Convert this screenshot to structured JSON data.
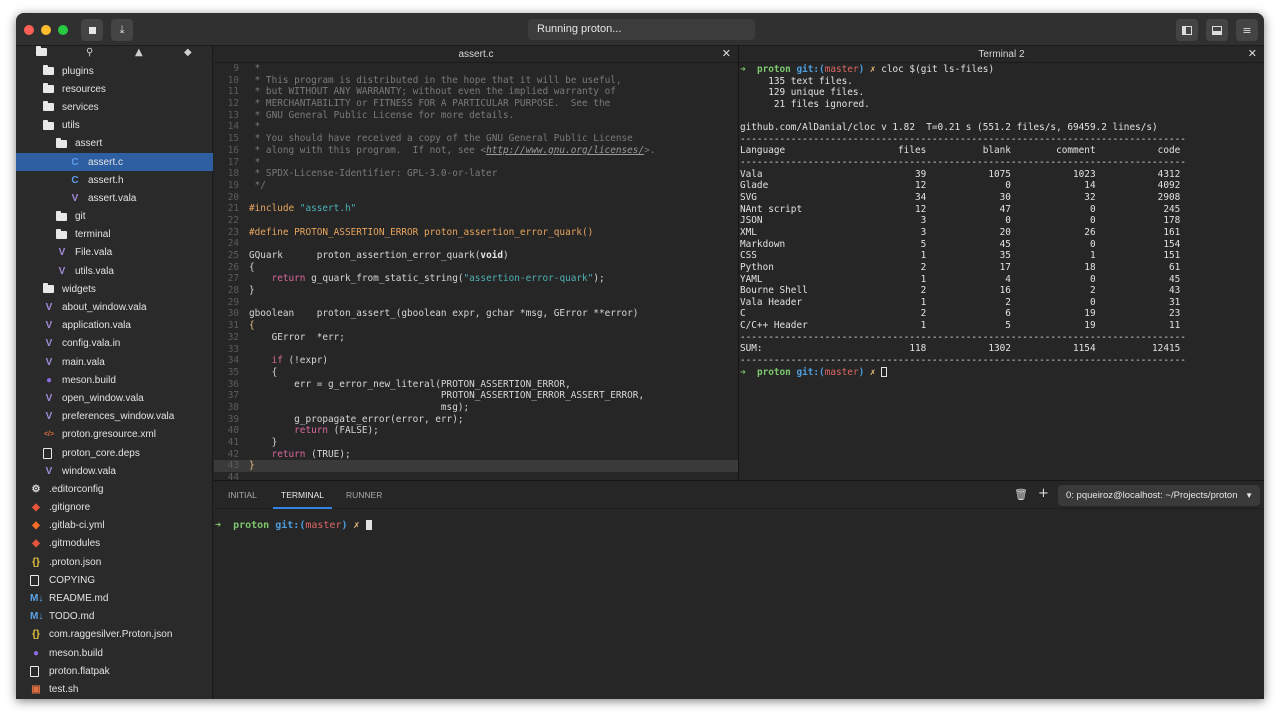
{
  "header": {
    "status": "Running proton...",
    "stop_icon": "stop-icon",
    "download_icon": "download-icon",
    "sidebar_toggle_icon": "sidebar-toggle-icon",
    "panel_toggle_icon": "panel-toggle-icon",
    "menu_icon": "hamburger-menu-icon"
  },
  "sidebar": {
    "toolbar_icons": [
      "folder-icon",
      "search-icon",
      "warning-icon",
      "git-icon"
    ],
    "items": [
      {
        "label": "plugins",
        "kind": "folder",
        "indent": 1
      },
      {
        "label": "resources",
        "kind": "folder",
        "indent": 1
      },
      {
        "label": "services",
        "kind": "folder",
        "indent": 1
      },
      {
        "label": "utils",
        "kind": "folder",
        "indent": 1
      },
      {
        "label": "assert",
        "kind": "folder",
        "indent": 2
      },
      {
        "label": "assert.c",
        "kind": "c",
        "indent": 3,
        "selected": true
      },
      {
        "label": "assert.h",
        "kind": "c",
        "indent": 3
      },
      {
        "label": "assert.vala",
        "kind": "vala",
        "indent": 3
      },
      {
        "label": "git",
        "kind": "folder",
        "indent": 2
      },
      {
        "label": "terminal",
        "kind": "folder",
        "indent": 2
      },
      {
        "label": "File.vala",
        "kind": "vala",
        "indent": 2
      },
      {
        "label": "utils.vala",
        "kind": "vala",
        "indent": 2
      },
      {
        "label": "widgets",
        "kind": "folder",
        "indent": 1
      },
      {
        "label": "about_window.vala",
        "kind": "vala",
        "indent": 1
      },
      {
        "label": "application.vala",
        "kind": "vala",
        "indent": 1
      },
      {
        "label": "config.vala.in",
        "kind": "vala",
        "indent": 1
      },
      {
        "label": "main.vala",
        "kind": "vala",
        "indent": 1
      },
      {
        "label": "meson.build",
        "kind": "meson",
        "indent": 1
      },
      {
        "label": "open_window.vala",
        "kind": "vala",
        "indent": 1
      },
      {
        "label": "preferences_window.vala",
        "kind": "vala",
        "indent": 1
      },
      {
        "label": "proton.gresource.xml",
        "kind": "xml",
        "indent": 1
      },
      {
        "label": "proton_core.deps",
        "kind": "file",
        "indent": 1
      },
      {
        "label": "window.vala",
        "kind": "vala",
        "indent": 1
      },
      {
        "label": ".editorconfig",
        "kind": "gear",
        "indent": 0
      },
      {
        "label": ".gitignore",
        "kind": "git",
        "indent": 0
      },
      {
        "label": ".gitlab-ci.yml",
        "kind": "gitlab",
        "indent": 0
      },
      {
        "label": ".gitmodules",
        "kind": "git",
        "indent": 0
      },
      {
        "label": ".proton.json",
        "kind": "json",
        "indent": 0
      },
      {
        "label": "COPYING",
        "kind": "file",
        "indent": 0
      },
      {
        "label": "README.md",
        "kind": "md",
        "indent": 0
      },
      {
        "label": "TODO.md",
        "kind": "md",
        "indent": 0
      },
      {
        "label": "com.raggesilver.Proton.json",
        "kind": "json",
        "indent": 0
      },
      {
        "label": "meson.build",
        "kind": "meson",
        "indent": 0
      },
      {
        "label": "proton.flatpak",
        "kind": "file",
        "indent": 0
      },
      {
        "label": "test.sh",
        "kind": "sh",
        "indent": 0
      }
    ]
  },
  "editor": {
    "title": "assert.c",
    "close": "✕",
    "lines": [
      {
        "n": "9",
        "html": "<span class='cm'> *</span>"
      },
      {
        "n": "10",
        "html": "<span class='cm'> * This program is distributed in the hope that it will be useful,</span>"
      },
      {
        "n": "11",
        "html": "<span class='cm'> * but WITHOUT ANY WARRANTY; without even the implied warranty of</span>"
      },
      {
        "n": "12",
        "html": "<span class='cm'> * MERCHANTABILITY or FITNESS FOR A PARTICULAR PURPOSE.  See the</span>"
      },
      {
        "n": "13",
        "html": "<span class='cm'> * GNU General Public License for more details.</span>"
      },
      {
        "n": "14",
        "html": "<span class='cm'> *</span>"
      },
      {
        "n": "15",
        "html": "<span class='cm'> * You should have received a copy of the GNU General Public License</span>"
      },
      {
        "n": "16",
        "html": "<span class='cm'> * along with this program.  If not, see &lt;</span><span class='lnk'>http://www.gnu.org/licenses/</span><span class='cm'>&gt;.</span>"
      },
      {
        "n": "17",
        "html": "<span class='cm'> *</span>"
      },
      {
        "n": "18",
        "html": "<span class='cm'> * SPDX-License-Identifier: GPL-3.0-or-later</span>"
      },
      {
        "n": "19",
        "html": "<span class='cm'> */</span>"
      },
      {
        "n": "20",
        "html": ""
      },
      {
        "n": "21",
        "html": "<span class='pp'>#include </span><span class='str'>\"assert.h\"</span>"
      },
      {
        "n": "22",
        "html": ""
      },
      {
        "n": "23",
        "html": "<span class='pp'>#define PROTON_ASSERTION_ERROR proton_assertion_error_quark()</span>"
      },
      {
        "n": "24",
        "html": ""
      },
      {
        "n": "25",
        "html": "<span class='tx'>GQuark      proton_assertion_error_quark(</span><span class='bold'>void</span><span class='tx'>)</span>"
      },
      {
        "n": "26",
        "html": "<span class='tx'>{</span>"
      },
      {
        "n": "27",
        "html": "<span class='tx'>    </span><span class='kw'>return</span><span class='tx'> g_quark_from_static_string(</span><span class='str'>\"assertion-error-quark\"</span><span class='tx'>);</span>"
      },
      {
        "n": "28",
        "html": "<span class='tx'>}</span>"
      },
      {
        "n": "29",
        "html": ""
      },
      {
        "n": "30",
        "html": "<span class='tx'>gboolean    proton_assert_(gboolean expr, gchar *msg, GError **error)</span>"
      },
      {
        "n": "31",
        "html": "<span class='yl'>{</span>"
      },
      {
        "n": "32",
        "html": "<span class='tx'>    GError  *err;</span>"
      },
      {
        "n": "33",
        "html": ""
      },
      {
        "n": "34",
        "html": "<span class='tx'>    </span><span class='kw'>if</span><span class='tx'> (!expr)</span>"
      },
      {
        "n": "35",
        "html": "<span class='tx'>    {</span>"
      },
      {
        "n": "36",
        "html": "<span class='tx'>        err = g_error_new_literal(PROTON_ASSERTION_ERROR,</span>"
      },
      {
        "n": "37",
        "html": "<span class='tx'>                                  PROTON_ASSERTION_ERROR_ASSERT_ERROR,</span>"
      },
      {
        "n": "38",
        "html": "<span class='tx'>                                  msg);</span>"
      },
      {
        "n": "39",
        "html": "<span class='tx'>        g_propagate_error(error, err);</span>"
      },
      {
        "n": "40",
        "html": "<span class='tx'>        </span><span class='kw'>return</span><span class='tx'> (FALSE);</span>"
      },
      {
        "n": "41",
        "html": "<span class='tx'>    }</span>"
      },
      {
        "n": "42",
        "html": "<span class='tx'>    </span><span class='kw'>return</span><span class='tx'> (TRUE);</span>"
      },
      {
        "n": "43",
        "html": "<span class='yl'>}</span>",
        "hl": true
      },
      {
        "n": "44",
        "html": ""
      }
    ]
  },
  "terminal2": {
    "title": "Terminal 2",
    "close": "✕",
    "prompt": {
      "arrow": "➜",
      "dir": "proton",
      "git": "git:(",
      "branch": "master",
      "close": ")",
      "mark": "✗"
    },
    "command": "cloc $(git ls-files)",
    "summary": [
      "     135 text files.",
      "     129 unique files.",
      "      21 files ignored."
    ],
    "version_line": "github.com/AlDanial/cloc v 1.82  T=0.21 s (551.2 files/s, 69459.2 lines/s)",
    "divider": "-------------------------------------------------------------------------------",
    "headers": [
      "Language",
      "files",
      "blank",
      "comment",
      "code"
    ],
    "rows": [
      [
        "Vala",
        "39",
        "1075",
        "1023",
        "4312"
      ],
      [
        "Glade",
        "12",
        "0",
        "14",
        "4092"
      ],
      [
        "SVG",
        "34",
        "30",
        "32",
        "2908"
      ],
      [
        "NAnt script",
        "12",
        "47",
        "0",
        "245"
      ],
      [
        "JSON",
        "3",
        "0",
        "0",
        "178"
      ],
      [
        "XML",
        "3",
        "20",
        "26",
        "161"
      ],
      [
        "Markdown",
        "5",
        "45",
        "0",
        "154"
      ],
      [
        "CSS",
        "1",
        "35",
        "1",
        "151"
      ],
      [
        "Python",
        "2",
        "17",
        "18",
        "61"
      ],
      [
        "YAML",
        "1",
        "4",
        "0",
        "45"
      ],
      [
        "Bourne Shell",
        "2",
        "16",
        "2",
        "43"
      ],
      [
        "Vala Header",
        "1",
        "2",
        "0",
        "31"
      ],
      [
        "C",
        "2",
        "6",
        "19",
        "23"
      ],
      [
        "C/C++ Header",
        "1",
        "5",
        "19",
        "11"
      ]
    ],
    "sum": [
      "SUM:",
      "118",
      "1302",
      "1154",
      "12415"
    ]
  },
  "bottom_panel": {
    "tabs": [
      "INITIAL",
      "TERMINAL",
      "RUNNER"
    ],
    "active_tab": "TERMINAL",
    "trash_icon": "trash-icon",
    "add_icon": "plus-icon",
    "terminal_select": "0: pqueiroz@localhost: ~/Projects/proton",
    "prompt": {
      "arrow": "➜",
      "dir": "proton",
      "git": "git:(",
      "branch": "master",
      "close": ")",
      "mark": "✗"
    }
  },
  "colors": {
    "accent": "#3584e4",
    "selection": "#2f5fa3",
    "prompt_green": "#7ec86e",
    "prompt_blue": "#4d9fe0",
    "prompt_red": "#e06767"
  }
}
